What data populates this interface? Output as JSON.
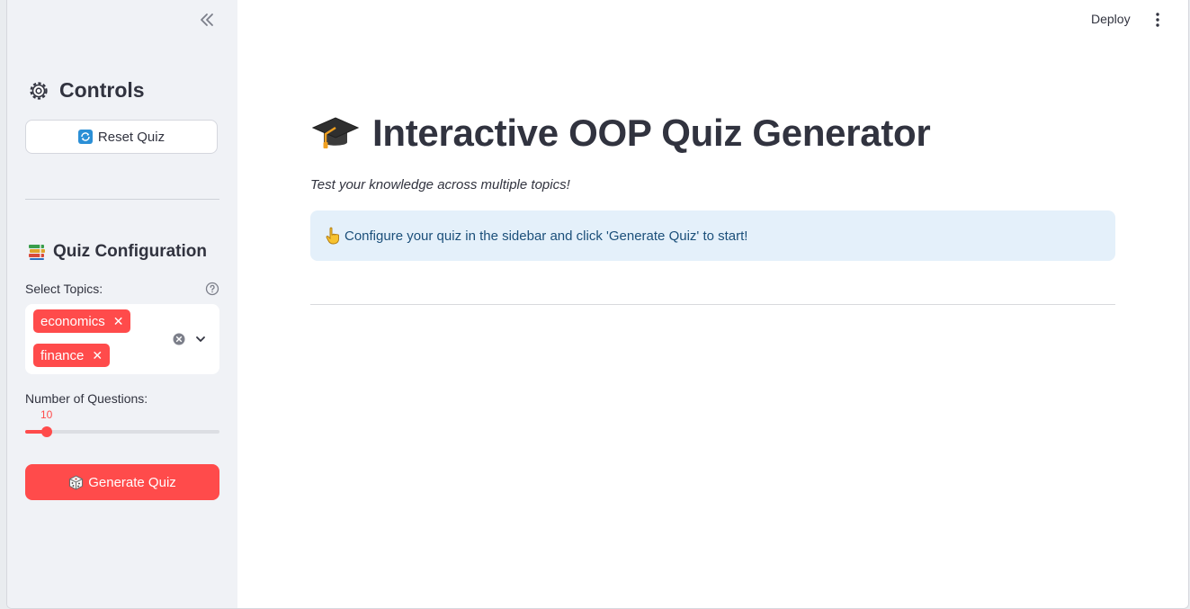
{
  "header": {
    "deploy_label": "Deploy",
    "menu_icon": "kebab-menu-icon"
  },
  "sidebar": {
    "collapse_icon": "double-chevron-left-icon",
    "controls_title": "Controls",
    "controls_icon": "gear-icon",
    "reset_button": {
      "icon": "refresh-icon",
      "label": "Reset Quiz"
    },
    "quiz_config_title": "Quiz Configuration",
    "quiz_config_icon": "books-icon",
    "topics": {
      "label": "Select Topics:",
      "selected": [
        "economics",
        "finance"
      ],
      "help_icon": "help-circle-icon"
    },
    "num_questions": {
      "label": "Number of Questions:",
      "value": "10",
      "fraction": 0.11
    },
    "generate_button": {
      "icon": "dice-icon",
      "label": "Generate Quiz"
    }
  },
  "main": {
    "title_icon": "graduation-cap-icon",
    "title": "Interactive OOP Quiz Generator",
    "subtitle": "Test your knowledge across multiple topics!",
    "info": {
      "icon": "pointing-hand-icon",
      "text": "Configure your quiz in the sidebar and click 'Generate Quiz' to start!"
    }
  },
  "colors": {
    "accent": "#ff4b4b",
    "sidebar_bg": "#f0f2f6",
    "info_bg": "#e4f0fa",
    "info_text": "#1b4f7a",
    "text": "#31333f"
  }
}
